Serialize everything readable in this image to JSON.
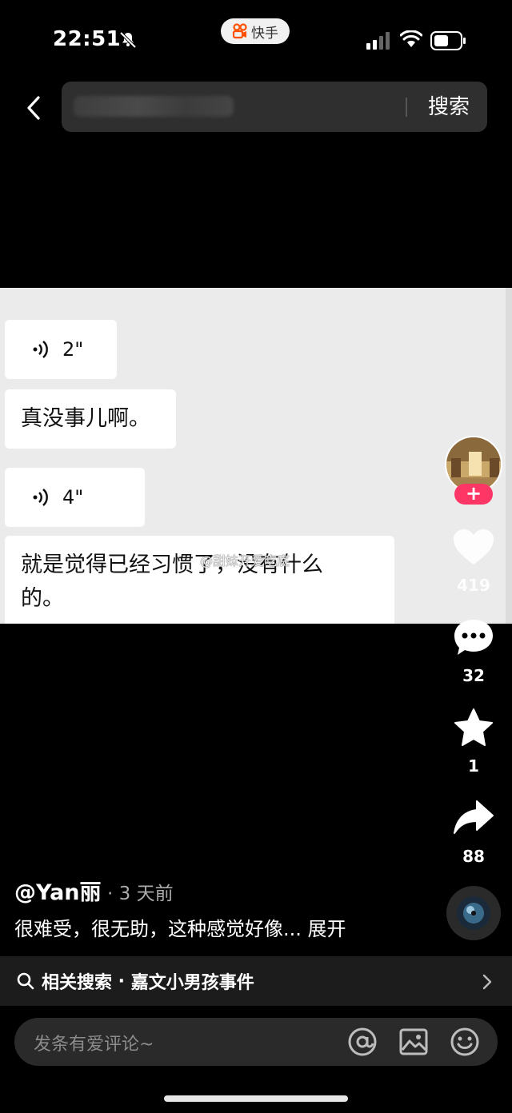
{
  "status_bar": {
    "time": "22:51",
    "app_badge": "快手"
  },
  "search": {
    "button_label": "搜索"
  },
  "chat": {
    "voice_1_duration": "2\"",
    "text_1": "真没事儿啊。",
    "voice_2_duration": "4\"",
    "text_2_line1": "就是觉得已经习惯了，没有什么",
    "text_2_line2": "的。",
    "watermark": "@甜妹开爱吃底"
  },
  "rail": {
    "follow_symbol": "+",
    "likes": "419",
    "comments": "32",
    "favorites": "1",
    "shares": "88"
  },
  "post": {
    "author": "@Yan丽",
    "time": "· 3 天前",
    "caption": "很难受，很无助，这种感觉好像...",
    "expand": " 展开"
  },
  "related": {
    "prefix": "相关搜索",
    "query": "嘉文小男孩事件",
    "sep": " · "
  },
  "comment": {
    "placeholder": "发条有爱评论~"
  },
  "colors": {
    "follow": "#fe3666",
    "panel": "#ebebeb",
    "background": "#000000"
  },
  "icons": [
    "bell-off-icon",
    "kuaishou-logo-icon",
    "signal-icon",
    "wifi-icon",
    "battery-icon",
    "back-arrow-icon",
    "voice-icon",
    "heart-icon",
    "comment-icon",
    "star-icon",
    "share-icon",
    "search-icon",
    "chevron-right-icon",
    "at-icon",
    "image-icon",
    "emoji-icon"
  ]
}
